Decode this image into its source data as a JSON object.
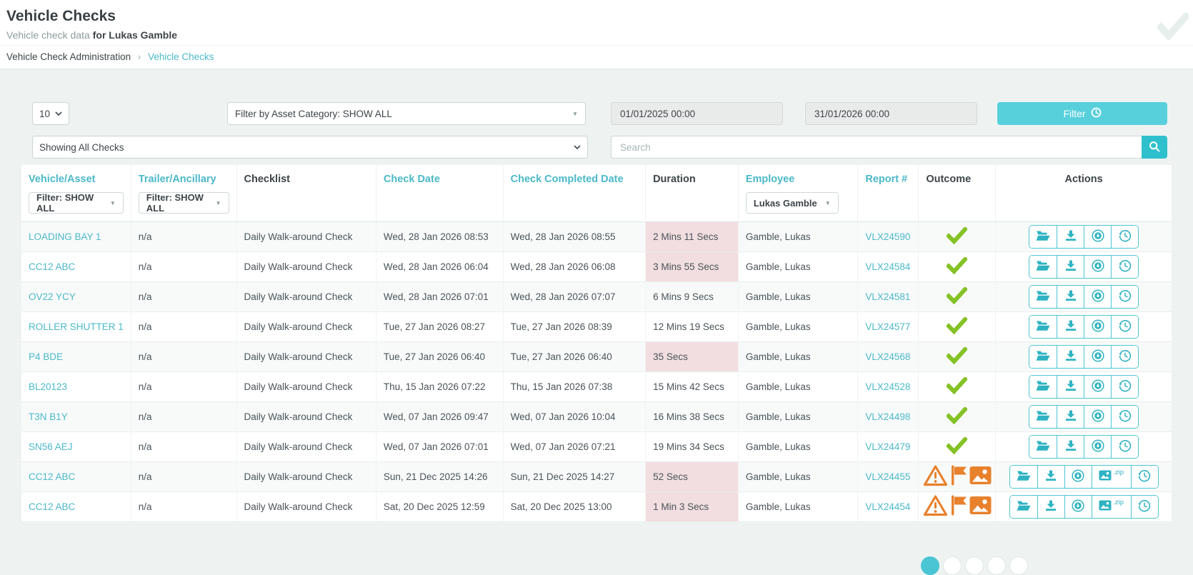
{
  "page": {
    "title": "Vehicle Checks",
    "subtitle_prefix": "Vehicle check data",
    "subtitle_bold": "for Lukas Gamble",
    "breadcrumb": {
      "parent": "Vehicle Check Administration",
      "separator": "›",
      "current": "Vehicle Checks"
    }
  },
  "filters": {
    "page_size": "10",
    "asset_category": "Filter by Asset Category: SHOW ALL",
    "date_from": "01/01/2025 00:00",
    "date_to": "31/01/2026 00:00",
    "filter_button": "Filter",
    "filter_button_icon": "clock-icon",
    "checks_scope": "Showing All Checks",
    "search_placeholder": "Search",
    "search_button_icon": "search-icon"
  },
  "table": {
    "columns": [
      "Vehicle/Asset",
      "Trailer/Ancillary",
      "Checklist",
      "Check Date",
      "Check Completed Date",
      "Duration",
      "Employee",
      "Report #",
      "Outcome",
      "Actions"
    ],
    "vehicle_filter": "Filter: SHOW ALL",
    "trailer_filter": "Filter: SHOW ALL",
    "employee_filter": "Lukas Gamble",
    "actions": {
      "zip_label": ".zip",
      "icons": [
        "open-folder-icon",
        "download-icon",
        "circle-down-arrow-icon",
        "images-zip-icon",
        "history-clock-icon"
      ]
    },
    "outcome_icons": {
      "pass": "green-check-icon",
      "issues": [
        "warning-triangle-icon",
        "flag-icon",
        "photos-icon"
      ]
    },
    "rows": [
      {
        "vehicle": "LOADING BAY 1",
        "trailer": "n/a",
        "checklist": "Daily Walk-around Check",
        "check_date": "Wed, 28 Jan 2026 08:53",
        "check_completed_date": "Wed, 28 Jan 2026 08:55",
        "duration": "2 Mins 11 Secs",
        "duration_flagged": true,
        "employee": "Gamble, Lukas",
        "report": "VLX24590",
        "outcome": "pass",
        "zip_download": false
      },
      {
        "vehicle": "CC12 ABC",
        "trailer": "n/a",
        "checklist": "Daily Walk-around Check",
        "check_date": "Wed, 28 Jan 2026 06:04",
        "check_completed_date": "Wed, 28 Jan 2026 06:08",
        "duration": "3 Mins 55 Secs",
        "duration_flagged": true,
        "employee": "Gamble, Lukas",
        "report": "VLX24584",
        "outcome": "pass",
        "zip_download": false
      },
      {
        "vehicle": "OV22 YCY",
        "trailer": "n/a",
        "checklist": "Daily Walk-around Check",
        "check_date": "Wed, 28 Jan 2026 07:01",
        "check_completed_date": "Wed, 28 Jan 2026 07:07",
        "duration": "6 Mins 9 Secs",
        "duration_flagged": false,
        "employee": "Gamble, Lukas",
        "report": "VLX24581",
        "outcome": "pass",
        "zip_download": false
      },
      {
        "vehicle": "ROLLER SHUTTER 1",
        "trailer": "n/a",
        "checklist": "Daily Walk-around Check",
        "check_date": "Tue, 27 Jan 2026 08:27",
        "check_completed_date": "Tue, 27 Jan 2026 08:39",
        "duration": "12 Mins 19 Secs",
        "duration_flagged": false,
        "employee": "Gamble, Lukas",
        "report": "VLX24577",
        "outcome": "pass",
        "zip_download": false
      },
      {
        "vehicle": "P4 BDE",
        "trailer": "n/a",
        "checklist": "Daily Walk-around Check",
        "check_date": "Tue, 27 Jan 2026 06:40",
        "check_completed_date": "Tue, 27 Jan 2026 06:40",
        "duration": "35 Secs",
        "duration_flagged": true,
        "employee": "Gamble, Lukas",
        "report": "VLX24568",
        "outcome": "pass",
        "zip_download": false
      },
      {
        "vehicle": "BL20123",
        "trailer": "n/a",
        "checklist": "Daily Walk-around Check",
        "check_date": "Thu, 15 Jan 2026 07:22",
        "check_completed_date": "Thu, 15 Jan 2026 07:38",
        "duration": "15 Mins 42 Secs",
        "duration_flagged": false,
        "employee": "Gamble, Lukas",
        "report": "VLX24528",
        "outcome": "pass",
        "zip_download": false
      },
      {
        "vehicle": "T3N B1Y",
        "trailer": "n/a",
        "checklist": "Daily Walk-around Check",
        "check_date": "Wed, 07 Jan 2026 09:47",
        "check_completed_date": "Wed, 07 Jan 2026 10:04",
        "duration": "16 Mins 38 Secs",
        "duration_flagged": false,
        "employee": "Gamble, Lukas",
        "report": "VLX24498",
        "outcome": "pass",
        "zip_download": false
      },
      {
        "vehicle": "SN56 AEJ",
        "trailer": "n/a",
        "checklist": "Daily Walk-around Check",
        "check_date": "Wed, 07 Jan 2026 07:01",
        "check_completed_date": "Wed, 07 Jan 2026 07:21",
        "duration": "19 Mins 34 Secs",
        "duration_flagged": false,
        "employee": "Gamble, Lukas",
        "report": "VLX24479",
        "outcome": "pass",
        "zip_download": false
      },
      {
        "vehicle": "CC12 ABC",
        "trailer": "n/a",
        "checklist": "Daily Walk-around Check",
        "check_date": "Sun, 21 Dec 2025 14:26",
        "check_completed_date": "Sun, 21 Dec 2025 14:27",
        "duration": "52 Secs",
        "duration_flagged": true,
        "employee": "Gamble, Lukas",
        "report": "VLX24455",
        "outcome": "issues",
        "zip_download": true
      },
      {
        "vehicle": "CC12 ABC",
        "trailer": "n/a",
        "checklist": "Daily Walk-around Check",
        "check_date": "Sat, 20 Dec 2025 12:59",
        "check_completed_date": "Sat, 20 Dec 2025 13:00",
        "duration": "1 Min 3 Secs",
        "duration_flagged": true,
        "employee": "Gamble, Lukas",
        "report": "VLX24454",
        "outcome": "issues",
        "zip_download": true
      }
    ]
  },
  "pagination": {
    "dot_count": 5,
    "active_index": 0
  },
  "colors": {
    "accent_teal": "#4bb9c9",
    "button_teal": "#57d0dc",
    "search_button_teal": "#2fc0ce",
    "pass_green": "#84c225",
    "warning_orange": "#e8812c",
    "flagged_duration_bg": "#f2dee0",
    "page_background": "#eef3f2"
  }
}
